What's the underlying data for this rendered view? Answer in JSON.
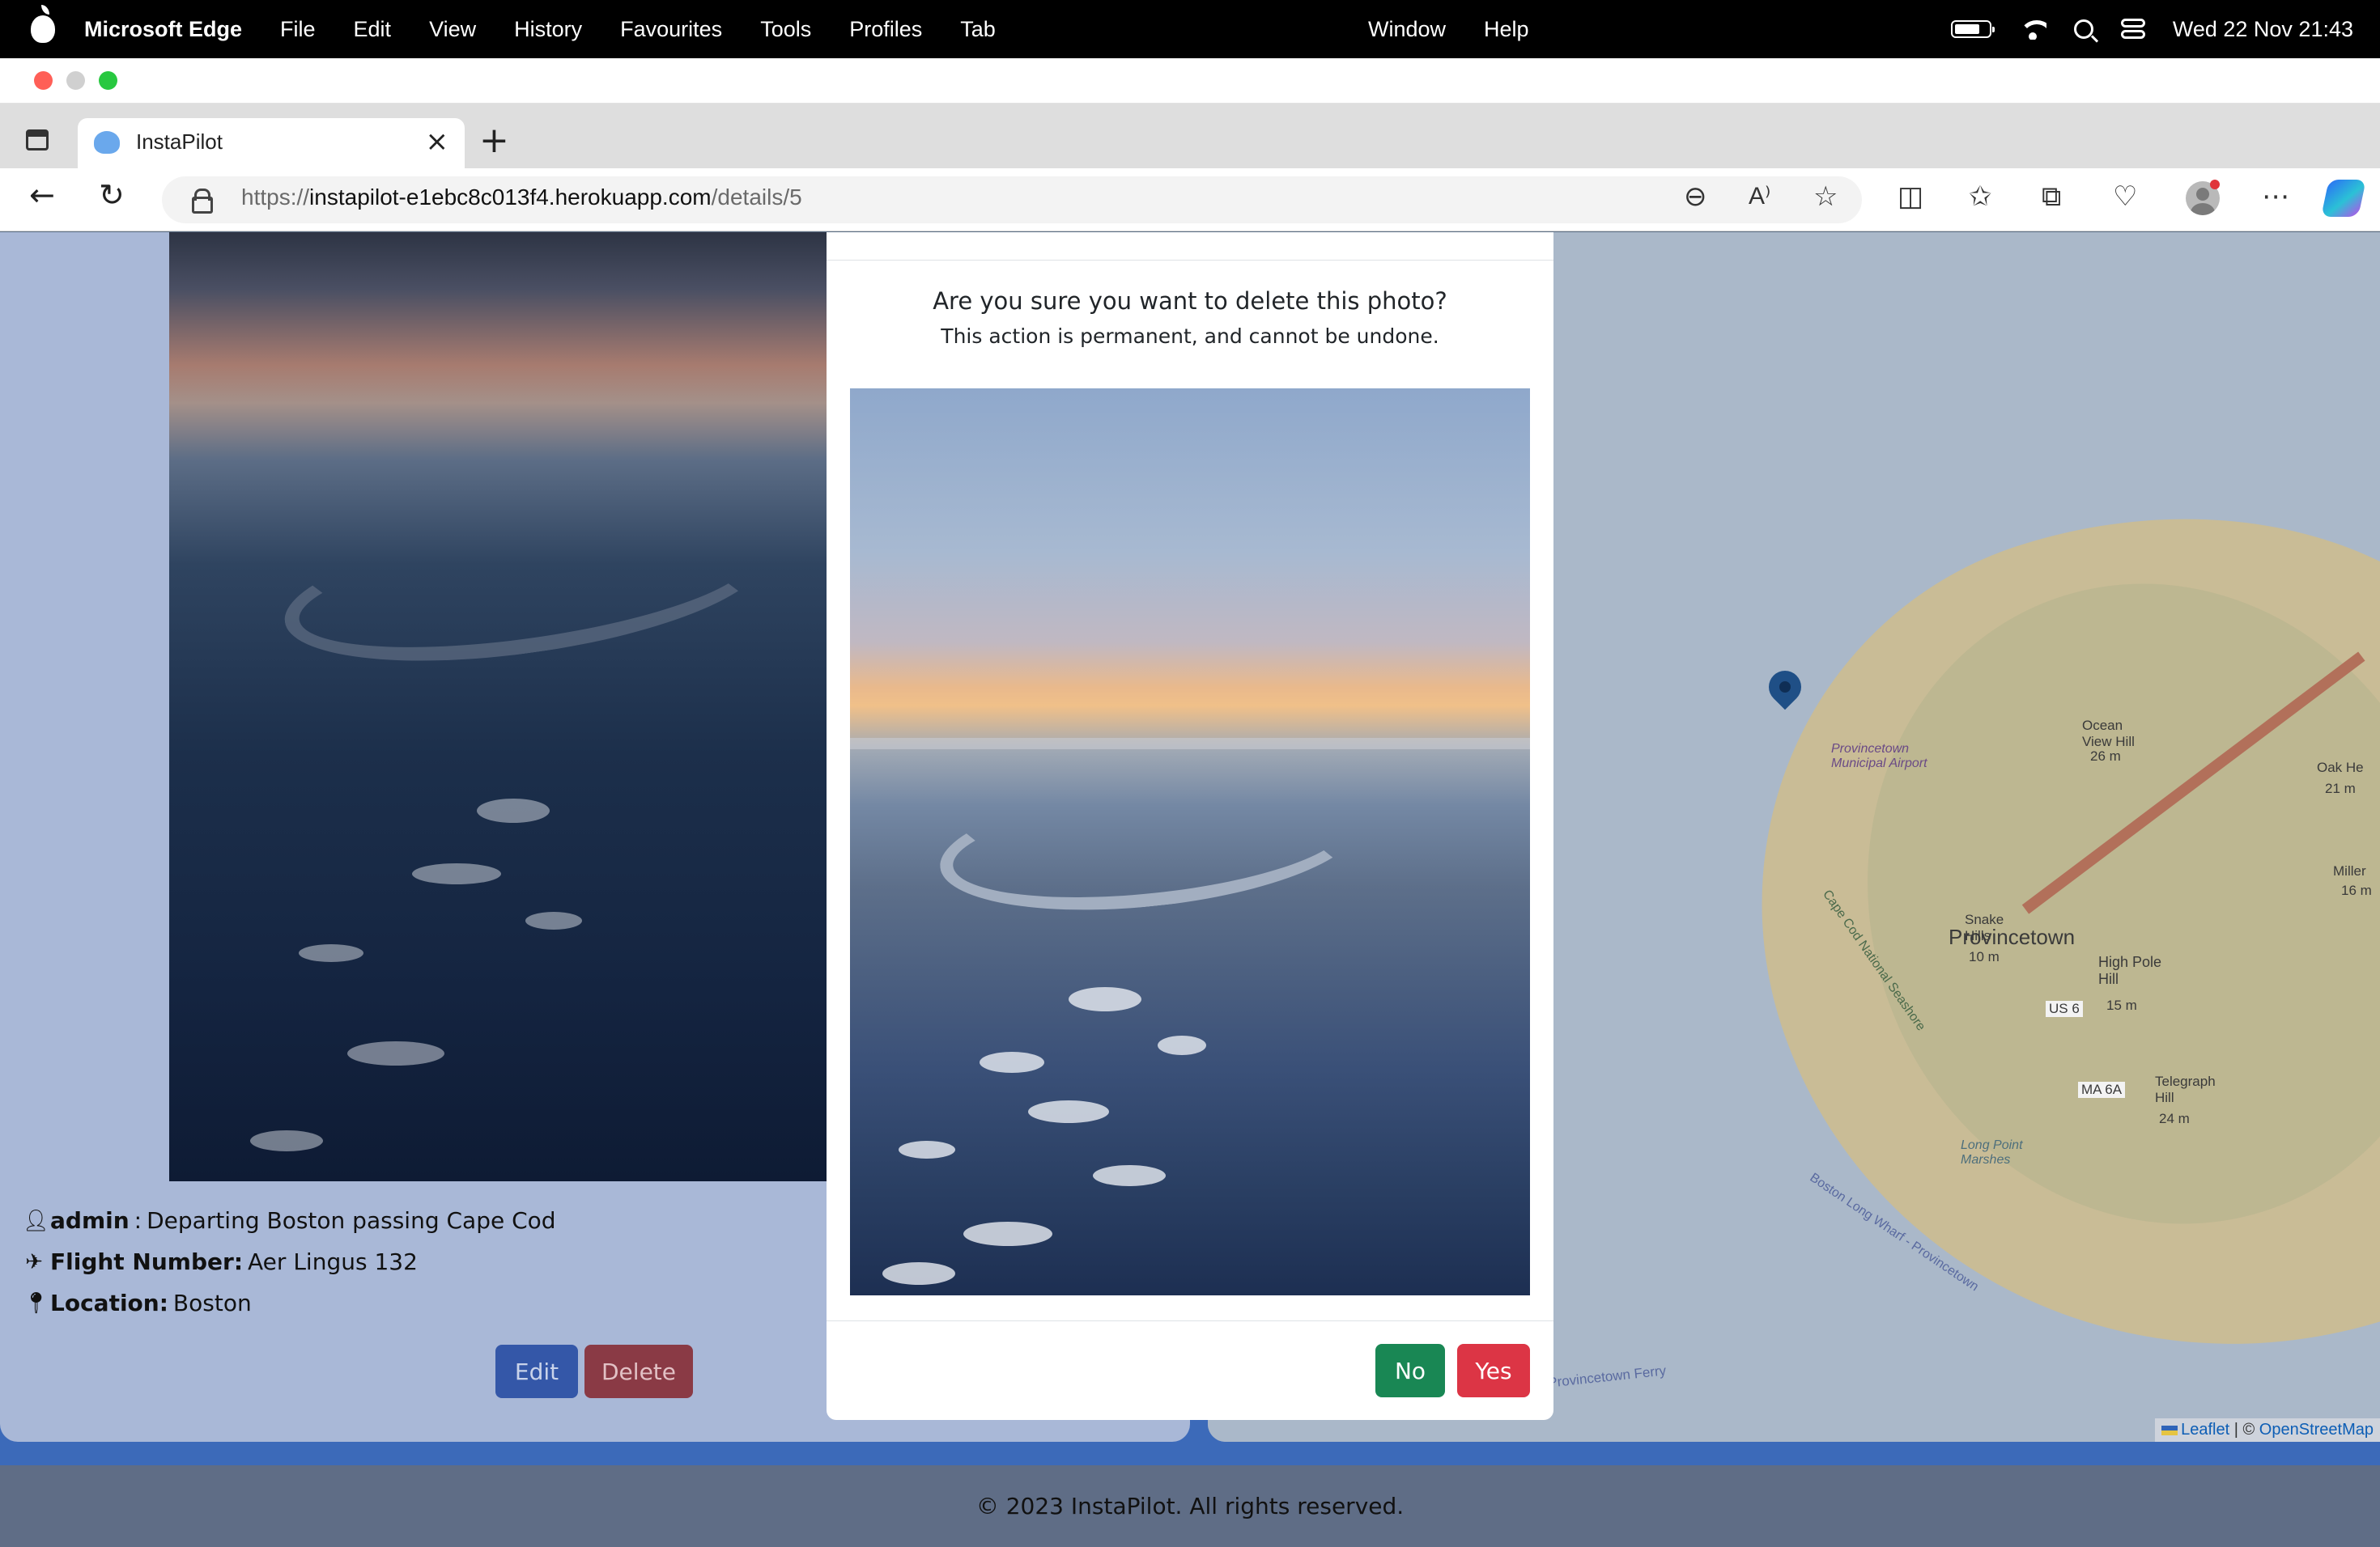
{
  "menubar": {
    "app_name": "Microsoft Edge",
    "items": [
      "File",
      "Edit",
      "View",
      "History",
      "Favourites",
      "Tools",
      "Profiles",
      "Tab"
    ],
    "right_items": [
      "Window",
      "Help"
    ],
    "clock": "Wed 22 Nov  21:43"
  },
  "browser": {
    "tab_title": "InstaPilot",
    "url_scheme": "https://",
    "url_host": "instapilot-e1ebc8c013f4.herokuapp.com",
    "url_path": "/details/5"
  },
  "post": {
    "user": "admin",
    "caption": "Departing Boston passing Cape Cod",
    "flight_label": "Flight Number:",
    "flight_value": "Aer Lingus 132",
    "location_label": "Location:",
    "location_value": "Boston",
    "edit_label": "Edit",
    "delete_label": "Delete"
  },
  "map": {
    "labels": {
      "provincetown": "Provincetown",
      "airport": "Provincetown Municipal Airport",
      "ocean_view": "Ocean View Hill",
      "ocean_view_h": "26 m",
      "snake_hills": "Snake Hills",
      "snake_hills_h": "10 m",
      "high_pole": "High Pole Hill",
      "high_pole_h": "15 m",
      "telegraph": "Telegraph Hill",
      "telegraph_h": "24 m",
      "long_point": "Long Point Marshes",
      "us6": "US 6",
      "ma6a": "MA 6A",
      "seashore": "Cape Cod National Seashore",
      "wharf": "Boston Long Wharf - Provincetown",
      "ferry": "Provincetown Ferry",
      "oak": "Oak He",
      "oak_h": "21 m",
      "miller": "Miller",
      "miller_h": "16 m"
    },
    "attribution_leaflet": "Leaflet",
    "attribution_sep": " | © ",
    "attribution_osm": "OpenStreetMap"
  },
  "footer": {
    "text": "© 2023 InstaPilot. All rights reserved."
  },
  "modal": {
    "question": "Are you sure you want to delete this photo?",
    "subtext": "This action is permanent, and cannot be undone.",
    "no_label": "No",
    "yes_label": "Yes"
  },
  "colors": {
    "no_button": "#198754",
    "yes_button": "#dc3545",
    "edit_button": "#0d6efd",
    "delete_button": "#dc3545"
  }
}
